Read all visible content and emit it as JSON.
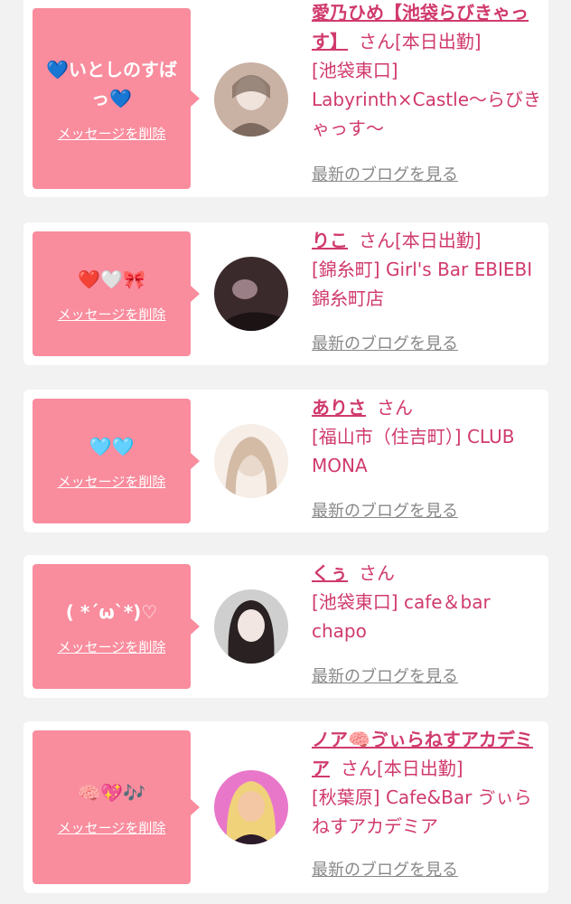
{
  "cards": [
    {
      "message": "💙いとしのすばっ💙",
      "delete_label": "メッセージを削除",
      "name": "愛乃ひめ【池袋らびきゃっす】",
      "suffix": "さん",
      "status": "[本日出勤]",
      "shop": "[池袋東口] Labyrinth×Castle〜らびきゃっす〜",
      "blog_label": "最新のブログを見る",
      "avatar_colors": [
        "#c9b2a4",
        "#efe3dc",
        "#7e6a5e"
      ]
    },
    {
      "message": "❤️🤍🎀",
      "delete_label": "メッセージを削除",
      "name": "りこ",
      "suffix": "さん",
      "status": "[本日出勤]",
      "shop": "[錦糸町] Girl's Bar EBIEBI 錦糸町店",
      "blog_label": "最新のブログを見る",
      "avatar_colors": [
        "#3b2a2c",
        "#9a7f86",
        "#1c1414"
      ]
    },
    {
      "message": "🩵🩵",
      "delete_label": "メッセージを削除",
      "name": "ありさ",
      "suffix": "さん",
      "status": "",
      "shop": "[福山市（住吉町）] CLUB MONA",
      "blog_label": "最新のブログを見る",
      "avatar_colors": [
        "#e8d9cc",
        "#d3bba6",
        "#f6eee7"
      ]
    },
    {
      "message": "( *´ω`*)♡",
      "delete_label": "メッセージを削除",
      "name": "くぅ",
      "suffix": "さん",
      "status": "",
      "shop": "[池袋東口] cafe＆bar chapo",
      "blog_label": "最新のブログを見る",
      "avatar_colors": [
        "#cfcfcf",
        "#2a2222",
        "#f1e6e2"
      ]
    },
    {
      "message": "🧠💖🎶",
      "delete_label": "メッセージを削除",
      "name": "ノア🧠ゔぃらねすアカデミア",
      "suffix": "さん",
      "status": "[本日出勤]",
      "shop": "[秋葉原] Cafe&Bar ゔぃらねすアカデミア",
      "blog_label": "最新のブログを見る",
      "avatar_colors": [
        "#e877c9",
        "#f3c6a4",
        "#2b1b2a"
      ]
    }
  ]
}
